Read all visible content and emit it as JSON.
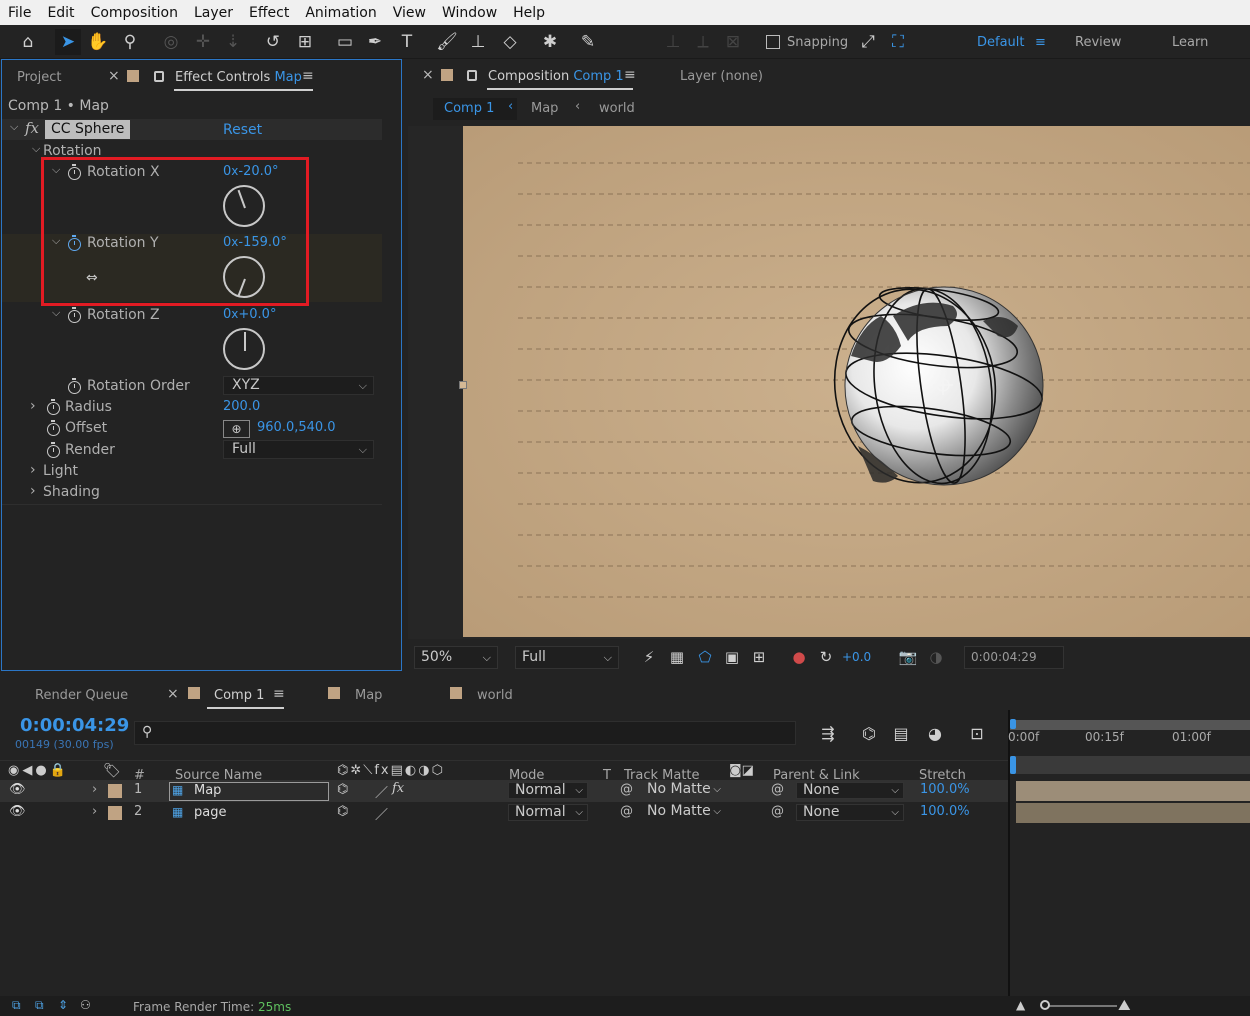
{
  "menu": [
    "File",
    "Edit",
    "Composition",
    "Layer",
    "Effect",
    "Animation",
    "View",
    "Window",
    "Help"
  ],
  "toolbar": {
    "snapping_label": "Snapping",
    "workspaces": [
      "Default",
      "Review",
      "Learn"
    ]
  },
  "left_panel": {
    "tab_project": "Project",
    "tab_effect_controls": "Effect Controls",
    "tab_effect_controls_target": "Map",
    "breadcrumb": "Comp 1 • Map",
    "effect_name": "CC Sphere",
    "reset_label": "Reset",
    "rotation_group": "Rotation",
    "rotation_x": {
      "label": "Rotation X",
      "revs": "0",
      "x": "x",
      "value": "-20.0",
      "unit": "°",
      "angle_deg": -20
    },
    "rotation_y": {
      "label": "Rotation Y",
      "revs": "0",
      "x": "x",
      "value": "-159.0",
      "unit": "°",
      "angle_deg": -159
    },
    "rotation_z": {
      "label": "Rotation Z",
      "revs": "0",
      "x": "x",
      "value": "+0.0",
      "unit": "°",
      "angle_deg": 0
    },
    "rotation_order": {
      "label": "Rotation Order",
      "value": "XYZ"
    },
    "radius": {
      "label": "Radius",
      "value": "200.0"
    },
    "offset": {
      "label": "Offset",
      "value": "960.0,540.0"
    },
    "render": {
      "label": "Render",
      "value": "Full"
    },
    "light_label": "Light",
    "shading_label": "Shading",
    "highlight_color": "#e21b23"
  },
  "viewer": {
    "tab_label": "Composition",
    "tab_target": "Comp 1",
    "layer_tab": "Layer (none)",
    "breadcrumbs": [
      "Comp 1",
      "Map",
      "world"
    ],
    "zoom": "50%",
    "resolution": "Full",
    "exposure": "+0.0",
    "timecode": "0:00:04:29",
    "bg_color": "#c6ab87"
  },
  "timeline": {
    "tabs": [
      "Render Queue",
      "Comp 1",
      "Map",
      "world"
    ],
    "current_time": "0:00:04:29",
    "frame_info": "00149 (30.00 fps)",
    "col_source_name": "Source Name",
    "col_mode": "Mode",
    "col_t": "T",
    "col_track_matte": "Track Matte",
    "col_parent": "Parent & Link",
    "col_stretch": "Stretch",
    "col_num": "#",
    "ruler": [
      "0:00f",
      "00:15f",
      "01:00f"
    ],
    "layers": [
      {
        "num": "1",
        "name": "Map",
        "mode": "Normal",
        "matte": "No Matte",
        "parent": "None",
        "stretch": "100.0%"
      },
      {
        "num": "2",
        "name": "page",
        "mode": "Normal",
        "matte": "No Matte",
        "parent": "None",
        "stretch": "100.0%"
      }
    ]
  },
  "status": {
    "label": "Frame Render Time:",
    "value": "25ms"
  }
}
